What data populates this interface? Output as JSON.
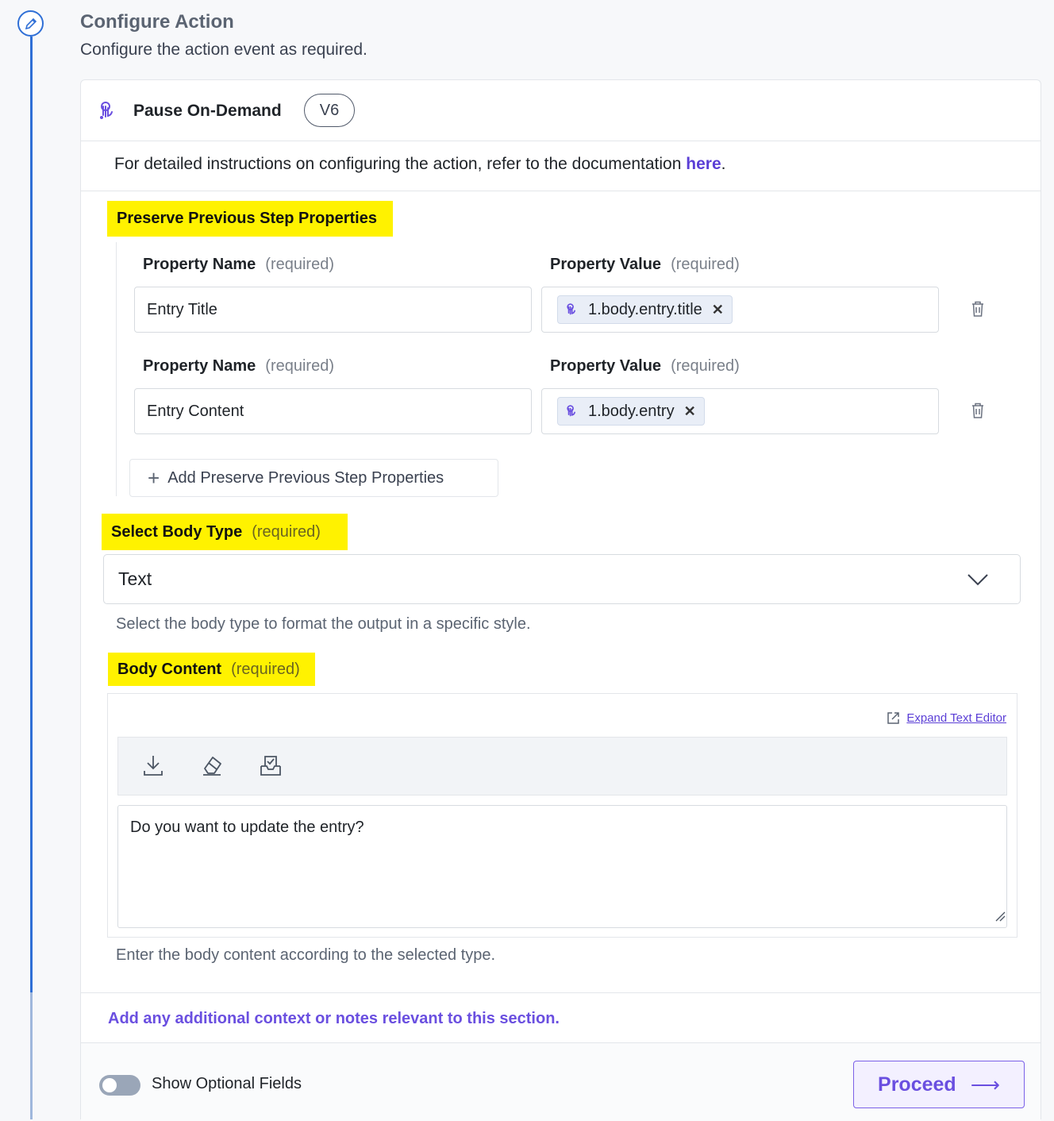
{
  "header": {
    "title": "Configure Action",
    "subtitle": "Configure the action event as required."
  },
  "action": {
    "name": "Pause On-Demand",
    "version": "V6",
    "icon": "pause-on-demand-icon"
  },
  "documentation": {
    "text": "For detailed instructions on configuring the action, refer to the documentation ",
    "link_label": "here",
    "suffix": "."
  },
  "preserve_section": {
    "title": "Preserve Previous Step Properties",
    "add_label": "Add Preserve Previous Step Properties",
    "rows": [
      {
        "name_label": "Property Name",
        "name_required": "(required)",
        "value_label": "Property Value",
        "value_required": "(required)",
        "name_value": "Entry Title",
        "value_chip": "1.body.entry.title"
      },
      {
        "name_label": "Property Name",
        "name_required": "(required)",
        "value_label": "Property Value",
        "value_required": "(required)",
        "name_value": "Entry Content",
        "value_chip": "1.body.entry"
      }
    ]
  },
  "body_type": {
    "label": "Select Body Type",
    "required": "(required)",
    "selected": "Text",
    "help": "Select the body type to format the output in a specific style."
  },
  "body_content": {
    "label": "Body Content",
    "required": "(required)",
    "expand_label": "Expand Text Editor",
    "toolbar_icons": [
      "download-icon",
      "eraser-icon",
      "inbox-check-icon"
    ],
    "value": "Do you want to update the entry?",
    "help": "Enter the body content according to the selected type."
  },
  "notes": "Add any additional context or notes relevant to this section.",
  "footer": {
    "toggle_label": "Show Optional Fields",
    "toggle_on": false,
    "proceed_label": "Proceed"
  },
  "colors": {
    "accent": "#6a4fe0",
    "rail": "#2f6fd6",
    "highlight": "#fff200"
  }
}
